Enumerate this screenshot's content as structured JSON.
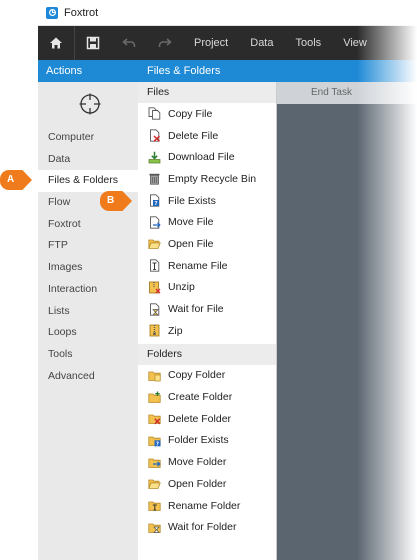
{
  "window": {
    "title": "Foxtrot"
  },
  "toolbar": {
    "icons": [
      "home-icon",
      "save-icon",
      "undo-icon",
      "redo-icon"
    ],
    "menus": [
      "Project",
      "Data",
      "Tools",
      "View"
    ]
  },
  "actions_header": "Actions",
  "panel_header": "Files & Folders",
  "canvas": {
    "end_task_label": "End Task"
  },
  "sidebar": {
    "icon": "target-icon",
    "items": [
      {
        "label": "Computer",
        "active": false
      },
      {
        "label": "Data",
        "active": false
      },
      {
        "label": "Files & Folders",
        "active": true
      },
      {
        "label": "Flow",
        "active": false
      },
      {
        "label": "Foxtrot",
        "active": false
      },
      {
        "label": "FTP",
        "active": false
      },
      {
        "label": "Images",
        "active": false
      },
      {
        "label": "Interaction",
        "active": false
      },
      {
        "label": "Lists",
        "active": false
      },
      {
        "label": "Loops",
        "active": false
      },
      {
        "label": "Tools",
        "active": false
      },
      {
        "label": "Advanced",
        "active": false
      }
    ]
  },
  "files": {
    "heading": "Files",
    "items": [
      {
        "label": "Copy File",
        "icon": "copy-file-icon"
      },
      {
        "label": "Delete File",
        "icon": "delete-file-icon"
      },
      {
        "label": "Download File",
        "icon": "download-file-icon"
      },
      {
        "label": "Empty Recycle Bin",
        "icon": "recycle-bin-icon"
      },
      {
        "label": "File Exists",
        "icon": "file-exists-icon"
      },
      {
        "label": "Move File",
        "icon": "move-file-icon"
      },
      {
        "label": "Open File",
        "icon": "open-file-icon"
      },
      {
        "label": "Rename File",
        "icon": "rename-file-icon"
      },
      {
        "label": "Unzip",
        "icon": "unzip-icon"
      },
      {
        "label": "Wait for File",
        "icon": "wait-file-icon"
      },
      {
        "label": "Zip",
        "icon": "zip-icon"
      }
    ]
  },
  "folders": {
    "heading": "Folders",
    "items": [
      {
        "label": "Copy Folder",
        "icon": "copy-folder-icon"
      },
      {
        "label": "Create Folder",
        "icon": "create-folder-icon"
      },
      {
        "label": "Delete Folder",
        "icon": "delete-folder-icon"
      },
      {
        "label": "Folder Exists",
        "icon": "folder-exists-icon"
      },
      {
        "label": "Move Folder",
        "icon": "move-folder-icon"
      },
      {
        "label": "Open Folder",
        "icon": "open-folder-icon"
      },
      {
        "label": "Rename Folder",
        "icon": "rename-folder-icon"
      },
      {
        "label": "Wait for Folder",
        "icon": "wait-folder-icon"
      }
    ]
  },
  "callouts": {
    "a": "A",
    "b": "B"
  },
  "colors": {
    "accent": "#1e8ad6",
    "toolbar": "#2b2b2b",
    "callout": "#f07b1c",
    "canvas": "#5b6570"
  }
}
